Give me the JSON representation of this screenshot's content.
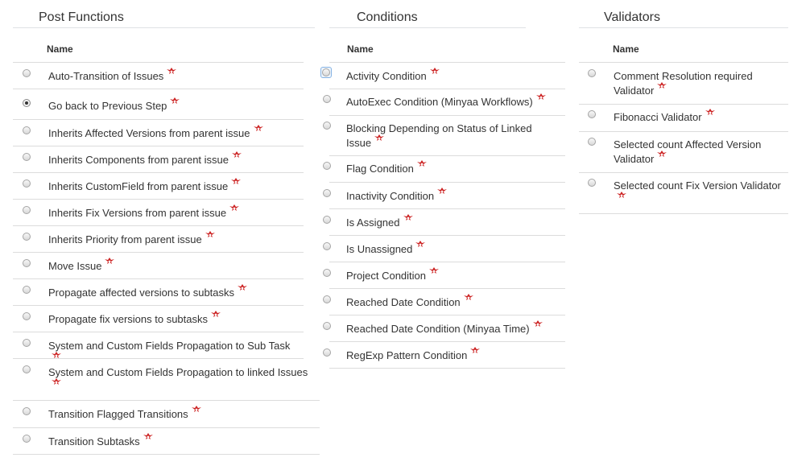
{
  "accent_colors": {
    "badge": "#cc2222",
    "border": "#dcdcdc"
  },
  "badge_icon": "minyaa-badge-icon",
  "post_functions": {
    "title": "Post Functions",
    "header": "Name",
    "items": [
      {
        "label": "Auto-Transition of Issues"
      },
      {
        "label": "Go back to Previous Step",
        "checked": true
      },
      {
        "label": "Inherits Affected Versions from parent issue"
      },
      {
        "label": "Inherits Components from parent issue"
      },
      {
        "label": "Inherits CustomField from parent issue"
      },
      {
        "label": "Inherits Fix Versions from parent issue"
      },
      {
        "label": "Inherits Priority from parent issue"
      },
      {
        "label": "Move Issue"
      },
      {
        "label": "Propagate affected versions to subtasks"
      },
      {
        "label": "Propagate fix versions to subtasks"
      },
      {
        "label": "System and Custom Fields Propagation to Sub Task"
      },
      {
        "label": "System and Custom Fields Propagation to linked Issues"
      },
      {
        "label": "Transition Flagged Transitions"
      },
      {
        "label": "Transition Subtasks"
      }
    ]
  },
  "conditions": {
    "title": "Conditions",
    "header": "Name",
    "items": [
      {
        "label": "Activity Condition",
        "focused": true
      },
      {
        "label": "AutoExec Condition (Minyaa Workflows)"
      },
      {
        "label": "Blocking Depending on Status of Linked Issue"
      },
      {
        "label": "Flag Condition"
      },
      {
        "label": "Inactivity Condition"
      },
      {
        "label": "Is Assigned"
      },
      {
        "label": "Is Unassigned"
      },
      {
        "label": "Project Condition"
      },
      {
        "label": "Reached Date Condition"
      },
      {
        "label": "Reached Date Condition (Minyaa Time)"
      },
      {
        "label": "RegExp Pattern Condition"
      }
    ]
  },
  "validators": {
    "title": "Validators",
    "header": "Name",
    "items": [
      {
        "label": "Comment Resolution required Validator"
      },
      {
        "label": "Fibonacci Validator"
      },
      {
        "label": "Selected count Affected Version Validator"
      },
      {
        "label": "Selected count Fix Version Validator"
      }
    ]
  }
}
